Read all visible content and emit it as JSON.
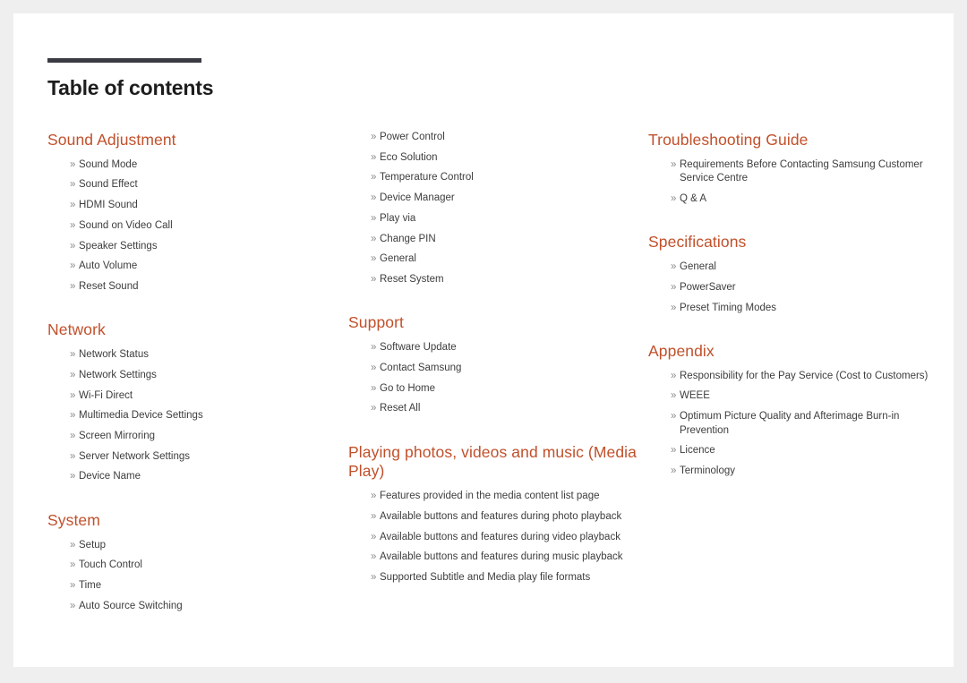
{
  "document": {
    "title": "Table of contents",
    "bullet_glyph": "»",
    "accent_color": "#c1502b",
    "rule_color": "#3b3b44",
    "title_color": "#1d1d1d",
    "item_color": "#3d3d3d",
    "page_background": "#ffffff",
    "canvas_background": "#efefef"
  },
  "columns": [
    {
      "name": "column-left",
      "sections": [
        {
          "title": "Sound Adjustment",
          "items": [
            "Sound Mode",
            "Sound Effect",
            "HDMI Sound",
            "Sound on Video Call",
            "Speaker Settings",
            "Auto Volume",
            "Reset Sound"
          ]
        },
        {
          "title": "Network",
          "items": [
            "Network Status",
            "Network Settings",
            "Wi-Fi Direct",
            "Multimedia Device Settings",
            "Screen Mirroring",
            "Server Network Settings",
            "Device Name"
          ]
        },
        {
          "title": "System",
          "items": [
            "Setup",
            "Touch Control",
            "Time",
            "Auto Source Switching"
          ]
        }
      ]
    },
    {
      "name": "column-middle",
      "sections": [
        {
          "title": "",
          "items": [
            "Power Control",
            "Eco Solution",
            "Temperature Control",
            "Device Manager",
            "Play via",
            "Change PIN",
            "General",
            "Reset System"
          ]
        },
        {
          "title": "Support",
          "items": [
            "Software Update",
            "Contact Samsung",
            "Go to Home",
            "Reset All"
          ]
        },
        {
          "title": "Playing photos, videos and music (Media Play)",
          "items": [
            "Features provided in the media content list page",
            "Available buttons and features during photo playback",
            "Available buttons and features during video playback",
            "Available buttons and features during music playback",
            "Supported Subtitle and Media play file formats"
          ]
        }
      ]
    },
    {
      "name": "column-right",
      "sections": [
        {
          "title": "Troubleshooting Guide",
          "items": [
            "Requirements Before Contacting Samsung Customer Service Centre",
            "Q & A"
          ]
        },
        {
          "title": "Specifications",
          "items": [
            "General",
            "PowerSaver",
            "Preset Timing Modes"
          ]
        },
        {
          "title": "Appendix",
          "items": [
            "Responsibility for the Pay Service (Cost to Customers)",
            "WEEE",
            "Optimum Picture Quality and Afterimage Burn-in Prevention",
            "Licence",
            "Terminology"
          ]
        }
      ]
    }
  ]
}
